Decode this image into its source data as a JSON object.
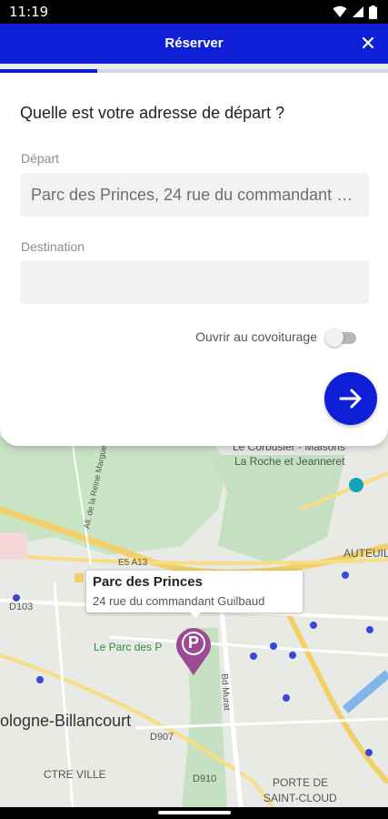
{
  "status_bar": {
    "time": "11:19"
  },
  "header": {
    "title": "Réserver"
  },
  "progress": {
    "fraction": 0.25
  },
  "form": {
    "question": "Quelle est votre adresse de départ ?",
    "departure_label": "Départ",
    "departure_value": "Parc des Princes, 24 rue du commandant Guilbaud",
    "destination_label": "Destination",
    "destination_value": "",
    "carpool_label": "Ouvrir au covoiturage",
    "carpool_enabled": false
  },
  "map": {
    "labels": {
      "le_corbusier": "Le Corbusier - Maisons",
      "la_roche": "La Roche et Jeanneret",
      "auteuil": "AUTEUIL",
      "d103": "D103",
      "parc_des_princes_area": "Le Parc des P",
      "boulogne": "ologne-Billancourt",
      "centre_ville": "CTRE VILLE",
      "porte_st_cloud_1": "PORTE DE",
      "porte_st_cloud_2": "SAINT-CLOUD",
      "d907": "D907",
      "d910": "D910",
      "a13": "E5 A13",
      "bd_murat": "Bd Murat",
      "allee": "All. de la Reine Marguerite"
    },
    "callout": {
      "title": "Parc des Princes",
      "subtitle": "24 rue du commandant Guilbaud"
    },
    "pin_letter": "P",
    "accent_color": "#0f1fd6",
    "pin_color": "#9c4a94"
  }
}
